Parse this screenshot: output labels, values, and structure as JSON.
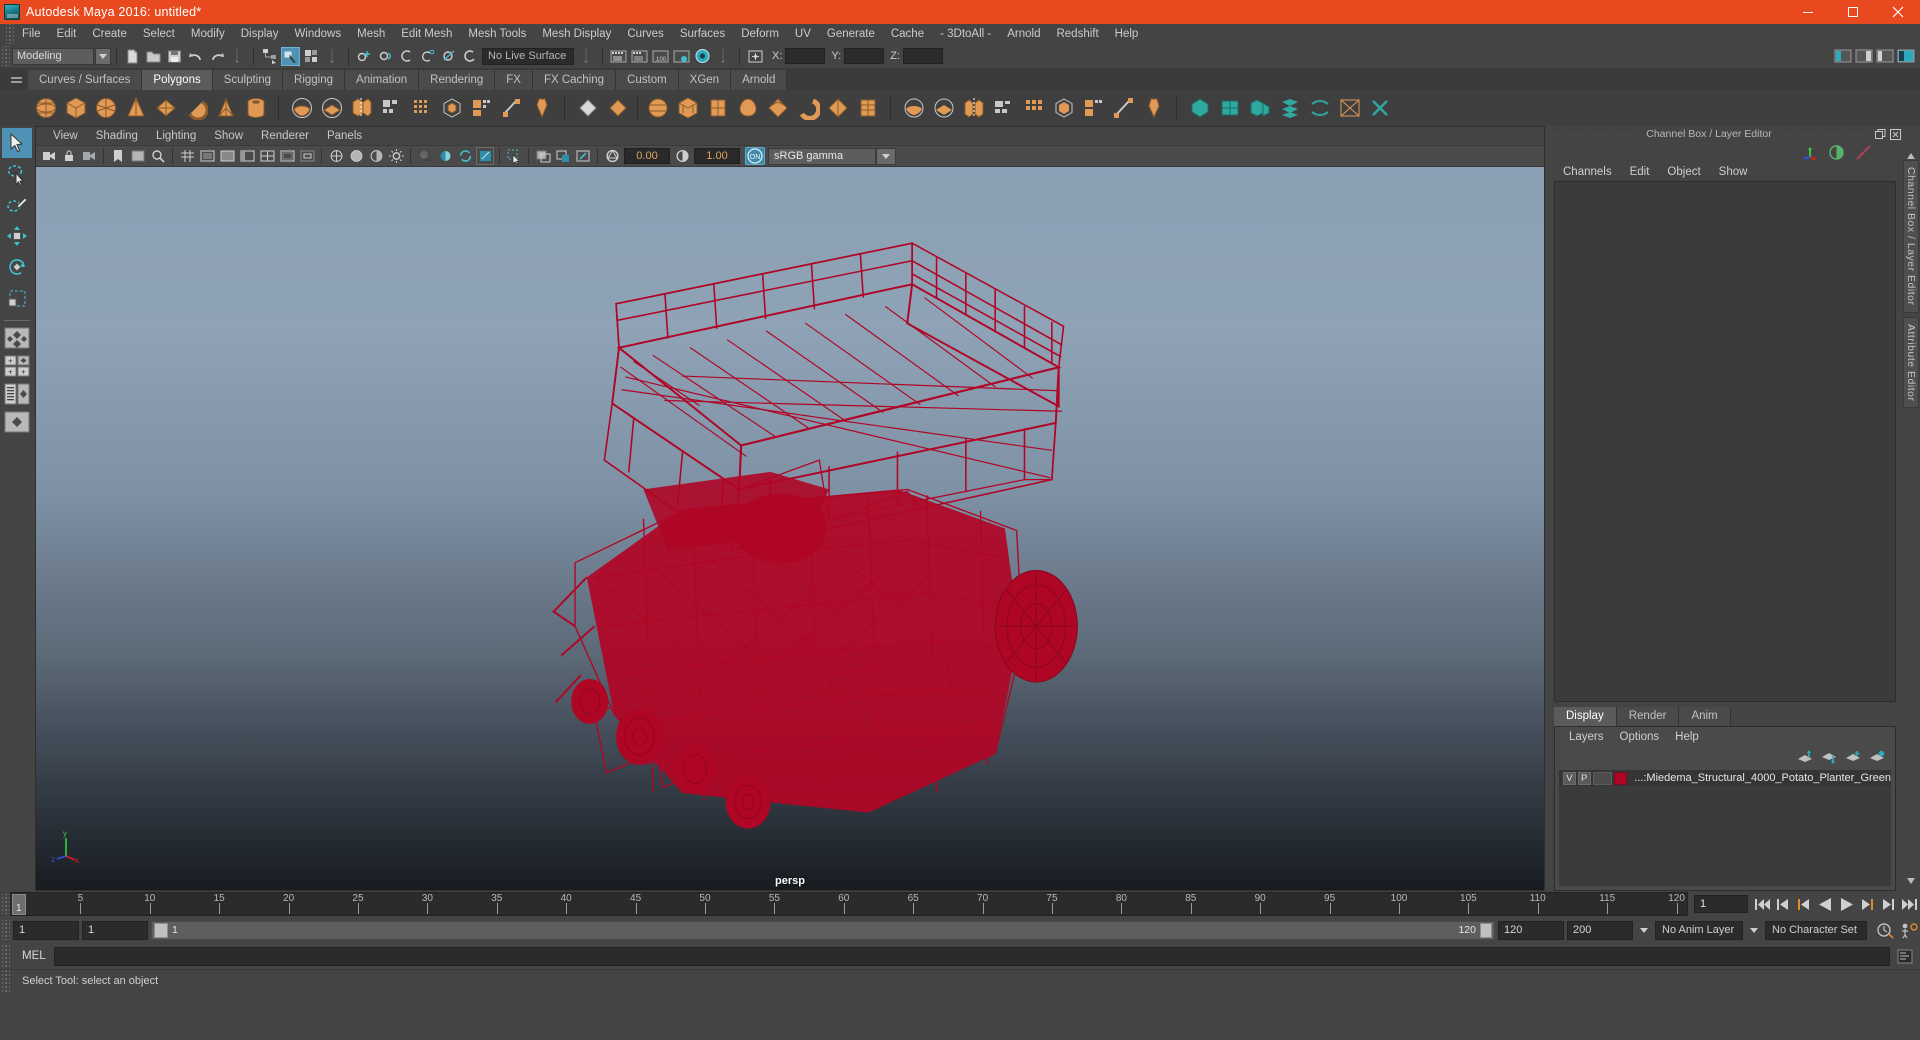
{
  "window": {
    "title": "Autodesk Maya 2016: untitled*",
    "logo_icon": "maya-logo-icon",
    "minimize_label": "minimize-icon",
    "maximize_label": "maximize-icon",
    "close_label": "close-icon"
  },
  "menubar": {
    "items": [
      "File",
      "Edit",
      "Create",
      "Select",
      "Modify",
      "Display",
      "Windows",
      "Mesh",
      "Edit Mesh",
      "Mesh Tools",
      "Mesh Display",
      "Curves",
      "Surfaces",
      "Deform",
      "UV",
      "Generate",
      "Cache",
      "- 3DtoAll -",
      "Arnold",
      "Redshift",
      "Help"
    ]
  },
  "statusbar": {
    "mode": "Modeling",
    "live_surface": "No Live Surface",
    "coord_labels": [
      "X:",
      "Y:",
      "Z:"
    ],
    "coord_values": [
      "",
      "",
      ""
    ]
  },
  "shelf": {
    "tabs": [
      "Curves / Surfaces",
      "Polygons",
      "Sculpting",
      "Rigging",
      "Animation",
      "Rendering",
      "FX",
      "FX Caching",
      "Custom",
      "XGen",
      "Arnold"
    ],
    "active_tab": "Polygons"
  },
  "viewport": {
    "menus": [
      "View",
      "Shading",
      "Lighting",
      "Show",
      "Renderer",
      "Panels"
    ],
    "exposure_value": "0.00",
    "gamma_value": "1.00",
    "color_management": "sRGB gamma",
    "color_management_toggle": "ON",
    "camera_label": "persp",
    "axis_labels": {
      "x": "x",
      "y": "y",
      "z": "z"
    },
    "model_color": "#b00626",
    "bg_top": "#8ba0b4",
    "bg_bottom": "#181c21"
  },
  "channel_box": {
    "panel_title": "Channel Box / Layer Editor",
    "menus": [
      "Channels",
      "Edit",
      "Object",
      "Show"
    ],
    "restore_icon": "restore-window-icon",
    "close_icon": "close-panel-icon"
  },
  "layer_editor": {
    "tabs": [
      "Display",
      "Render",
      "Anim"
    ],
    "active_tab": "Display",
    "menus": [
      "Layers",
      "Options",
      "Help"
    ],
    "layers": [
      {
        "visibility": "V",
        "playback": "P",
        "color": "#b00626",
        "name": "...:Miedema_Structural_4000_Potato_Planter_Green"
      }
    ]
  },
  "sidetabs": [
    "Channel Box / Layer Editor",
    "Attribute Editor"
  ],
  "timeline": {
    "tick_labels": [
      "5",
      "10",
      "15",
      "20",
      "25",
      "30",
      "35",
      "40",
      "45",
      "50",
      "55",
      "60",
      "65",
      "70",
      "75",
      "80",
      "85",
      "90",
      "95",
      "100",
      "105",
      "110",
      "115",
      "120"
    ],
    "current_frame_marker": "1",
    "current_frame_field": "1",
    "playback_buttons": [
      "go-to-start",
      "step-back-key",
      "step-back-frame",
      "play-backwards",
      "play-forwards",
      "step-forward-frame",
      "step-forward-key",
      "go-to-end"
    ]
  },
  "range_slider": {
    "start_field": "1",
    "playback_start_field": "1",
    "bar_left_label": "1",
    "bar_right_label": "120",
    "playback_end_field": "120",
    "end_field": "200",
    "anim_layer": "No Anim Layer",
    "character_set": "No Character Set",
    "anim_prefs_icon": "animation-preferences-icon",
    "char_set_icon": "character-set-icon"
  },
  "command_line": {
    "language_label": "MEL",
    "input_value": "",
    "script_editor_icon": "script-editor-icon"
  },
  "help_line": {
    "text": "Select Tool: select an object",
    "tool_icon": "help-tool-icon"
  },
  "toolbox": {
    "items": [
      {
        "name": "select-tool",
        "active": true
      },
      {
        "name": "lasso-select-tool",
        "active": false
      },
      {
        "name": "paint-select-tool",
        "active": false
      },
      {
        "name": "move-tool",
        "active": false
      },
      {
        "name": "rotate-tool",
        "active": false
      },
      {
        "name": "scale-tool",
        "active": false
      },
      {
        "name": "four-view-layout",
        "active": false
      },
      {
        "name": "persp-outliner-layout",
        "active": false
      },
      {
        "name": "persp-graph-layout",
        "active": false
      },
      {
        "name": "single-persp-layout",
        "active": false
      }
    ]
  }
}
